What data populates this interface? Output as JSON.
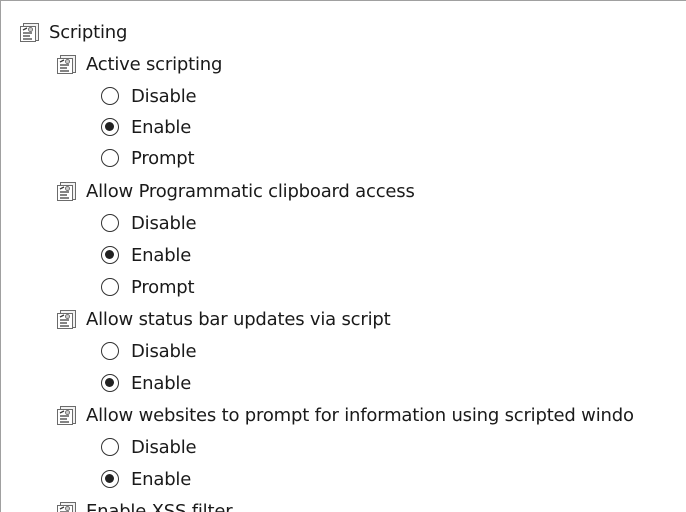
{
  "category": {
    "label": "Scripting",
    "icon": "policy-script-icon"
  },
  "settings": [
    {
      "label": "Active scripting",
      "icon": "policy-script-icon",
      "options": [
        {
          "label": "Disable",
          "selected": false
        },
        {
          "label": "Enable",
          "selected": true
        },
        {
          "label": "Prompt",
          "selected": false
        }
      ]
    },
    {
      "label": "Allow Programmatic clipboard access",
      "icon": "policy-script-icon",
      "options": [
        {
          "label": "Disable",
          "selected": false
        },
        {
          "label": "Enable",
          "selected": true
        },
        {
          "label": "Prompt",
          "selected": false
        }
      ]
    },
    {
      "label": "Allow status bar updates via script",
      "icon": "policy-script-icon",
      "options": [
        {
          "label": "Disable",
          "selected": false
        },
        {
          "label": "Enable",
          "selected": true
        }
      ]
    },
    {
      "label": "Allow websites to prompt for information using scripted windo",
      "icon": "policy-script-icon",
      "options": [
        {
          "label": "Disable",
          "selected": false
        },
        {
          "label": "Enable",
          "selected": true
        }
      ]
    },
    {
      "label": "Enable XSS filter",
      "icon": "policy-script-icon",
      "options": []
    }
  ],
  "colors": {
    "background": "#ffffff",
    "text": "#1a1a1a",
    "border": "#a0a0a0",
    "radio_border": "#333333",
    "radio_dot": "#222222"
  }
}
